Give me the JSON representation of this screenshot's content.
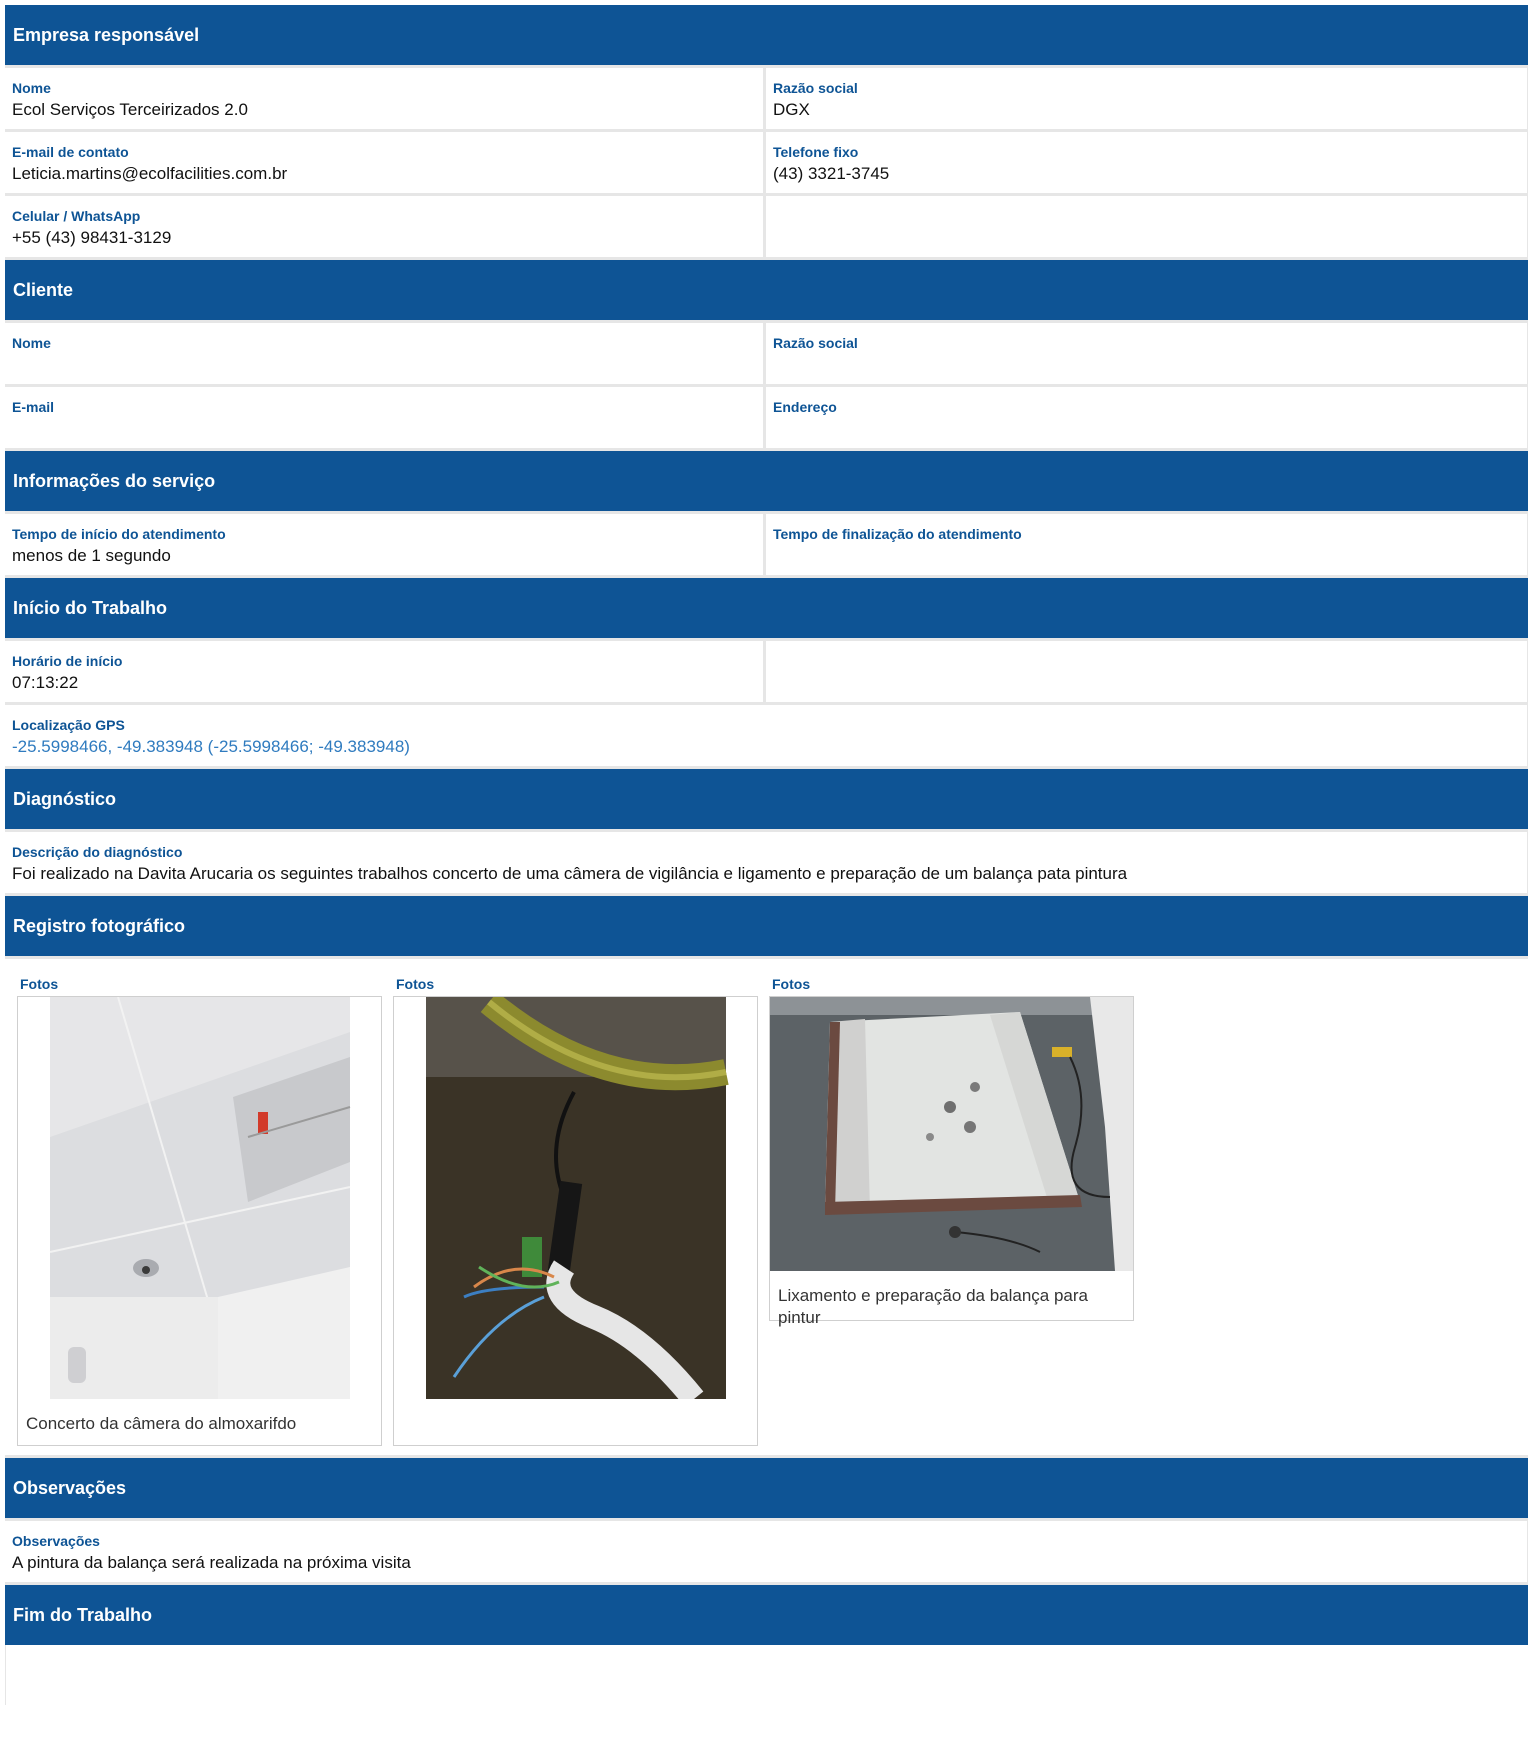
{
  "empresa": {
    "title": "Empresa responsável",
    "nome_label": "Nome",
    "nome_value": "Ecol Serviços Terceirizados 2.0",
    "razao_label": "Razão social",
    "razao_value": "DGX",
    "email_label": "E-mail de contato",
    "email_value": "Leticia.martins@ecolfacilities.com.br",
    "telefone_label": "Telefone fixo",
    "telefone_value": "(43) 3321-3745",
    "celular_label": "Celular / WhatsApp",
    "celular_value": "+55 (43) 98431-3129"
  },
  "cliente": {
    "title": "Cliente",
    "nome_label": "Nome",
    "razao_label": "Razão social",
    "email_label": "E-mail",
    "endereco_label": "Endereço"
  },
  "servico": {
    "title": "Informações do serviço",
    "inicio_label": "Tempo de início do atendimento",
    "inicio_value": "menos de 1 segundo",
    "fim_label": "Tempo de finalização do atendimento"
  },
  "inicio_trabalho": {
    "title": "Início do Trabalho",
    "horario_label": "Horário de início",
    "horario_value": "07:13:22",
    "gps_label": "Localização GPS",
    "gps_value": "-25.5998466, -49.383948 (-25.5998466; -49.383948)"
  },
  "diagnostico": {
    "title": "Diagnóstico",
    "descricao_label": "Descrição do diagnóstico",
    "descricao_value": "Foi realizado na Davita Arucaria os seguintes trabalhos concerto de uma câmera de vigilância e ligamento e preparação de um balança pata pintura"
  },
  "registro": {
    "title": "Registro fotográfico",
    "photos": [
      {
        "label": "Fotos",
        "caption": "Concerto da câmera do almoxarifdo"
      },
      {
        "label": "Fotos",
        "caption": ""
      },
      {
        "label": "Fotos",
        "caption": "Lixamento e preparação da balança para pintur"
      }
    ]
  },
  "observacoes": {
    "title": "Observações",
    "label": "Observações",
    "value": "A pintura da balança será realizada na próxima visita"
  },
  "fim_trabalho": {
    "title": "Fim do Trabalho"
  },
  "colors": {
    "header_bg": "#0e5495",
    "label": "#0e5495",
    "link": "#2f7bbf"
  }
}
